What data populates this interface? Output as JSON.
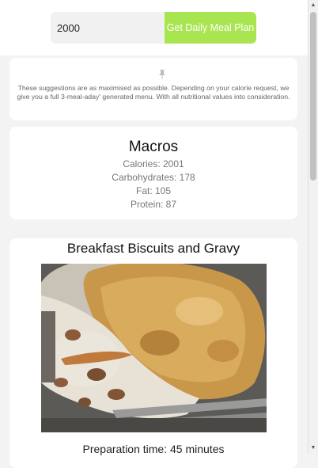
{
  "header": {
    "calorie_input_value": "2000",
    "button_label": "Get Daily Meal Plan"
  },
  "info": {
    "icon": "pin-icon",
    "text": "These suggestions are as maximised as possible. Depending on your calorie request, we give you a full 3-meal-aday' generated menu. With all nutritional values into consideration."
  },
  "macros": {
    "title": "Macros",
    "calories": "Calories: 2001",
    "carbohydrates": "Carbohydrates: 178",
    "fat": "Fat: 105",
    "protein": "Protein: 87"
  },
  "meal": {
    "title": "Breakfast Biscuits and Gravy",
    "image_alt": "biscuits-and-gravy-photo",
    "prep_time": "Preparation time: 45 minutes"
  },
  "colors": {
    "accent": "#a9e551",
    "page_background": "#f3f3f3",
    "card_background": "#ffffff"
  }
}
